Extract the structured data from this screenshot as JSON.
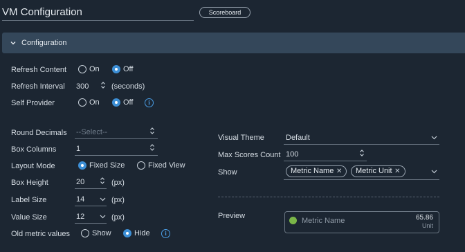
{
  "header": {
    "title": "VM Configuration",
    "scoreboard_label": "Scoreboard"
  },
  "section": {
    "label": "Configuration"
  },
  "left": {
    "refresh_content": {
      "label": "Refresh Content",
      "on": "On",
      "off": "Off",
      "selected": "Off"
    },
    "refresh_interval": {
      "label": "Refresh Interval",
      "value": "300",
      "unit": "(seconds)"
    },
    "self_provider": {
      "label": "Self Provider",
      "on": "On",
      "off": "Off",
      "selected": "Off"
    },
    "round_decimals": {
      "label": "Round Decimals",
      "placeholder": "--Select--"
    },
    "box_columns": {
      "label": "Box Columns",
      "value": "1"
    },
    "layout_mode": {
      "label": "Layout Mode",
      "fixed_size": "Fixed Size",
      "fixed_view": "Fixed View",
      "selected": "Fixed Size"
    },
    "box_height": {
      "label": "Box Height",
      "value": "20",
      "unit": "(px)"
    },
    "label_size": {
      "label": "Label Size",
      "value": "14",
      "unit": "(px)"
    },
    "value_size": {
      "label": "Value Size",
      "value": "12",
      "unit": "(px)"
    },
    "old_metric_values": {
      "label": "Old metric values",
      "show": "Show",
      "hide": "Hide",
      "selected": "Hide"
    }
  },
  "right": {
    "visual_theme": {
      "label": "Visual Theme",
      "value": "Default"
    },
    "max_scores_count": {
      "label": "Max Scores Count",
      "value": "100"
    },
    "show": {
      "label": "Show",
      "chips": [
        "Metric Name",
        "Metric Unit"
      ]
    },
    "preview": {
      "label": "Preview",
      "metric_name": "Metric Name",
      "metric_value": "65.86",
      "metric_unit": "Unit",
      "dot_color": "#7ab648"
    }
  },
  "colors": {
    "background": "#1c2632",
    "section_header": "#34475a",
    "accent": "#3d8fd6",
    "info": "#4a9ee6"
  }
}
